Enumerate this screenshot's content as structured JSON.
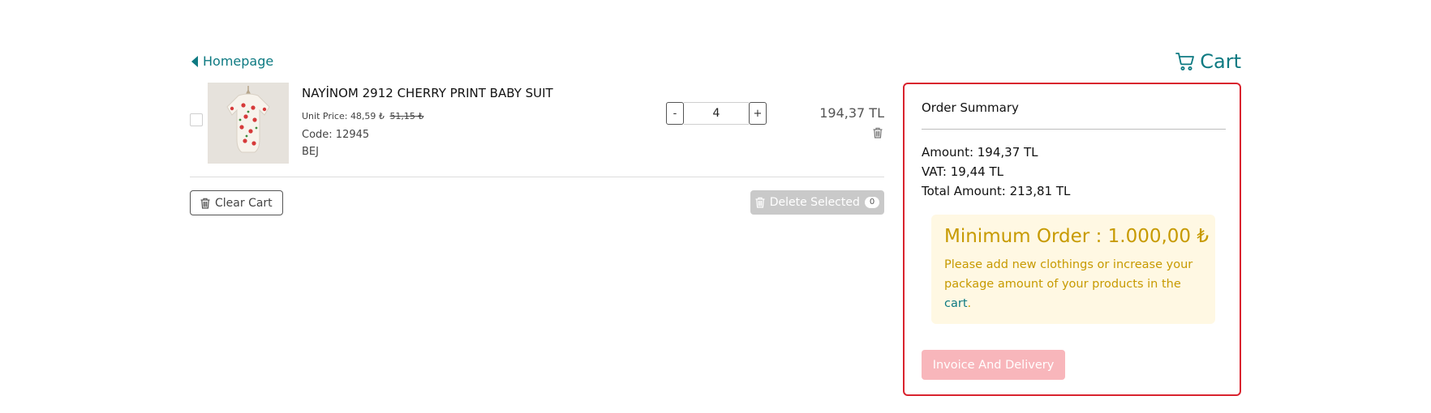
{
  "nav": {
    "back_label": "Homepage",
    "cart_title": "Cart"
  },
  "colors": {
    "accent": "#0e7a82",
    "summary_border": "#d9232e",
    "warning_text": "#c79a00",
    "warning_bg": "#fff8e3",
    "disabled_button": "#f8b6bb"
  },
  "item": {
    "name": "NAYİNOM 2912 CHERRY PRINT BABY SUIT",
    "unit_price_label": "Unit Price:",
    "unit_price": "48,59 ₺",
    "old_price": "51,15 ₺",
    "code": "Code: 12945",
    "color": "BEJ",
    "quantity": "4",
    "qty_minus": "-",
    "qty_plus": "+",
    "line_total": "194,37 TL",
    "image_icon": "baby-suit-image"
  },
  "actions": {
    "clear_cart": "Clear Cart",
    "delete_selected": "Delete Selected",
    "selected_count": "0"
  },
  "summary": {
    "title": "Order Summary",
    "amount": "Amount: 194,37 TL",
    "vat": "VAT: 19,44 TL",
    "total": "Total Amount: 213,81 TL",
    "min_order_title": "Minimum Order : 1.000,00 ₺",
    "min_order_text": "Please add new clothings or increase your package amount of your products in the",
    "min_order_link": "cart",
    "min_order_end": ".",
    "invoice_button": "Invoice And Delivery"
  }
}
